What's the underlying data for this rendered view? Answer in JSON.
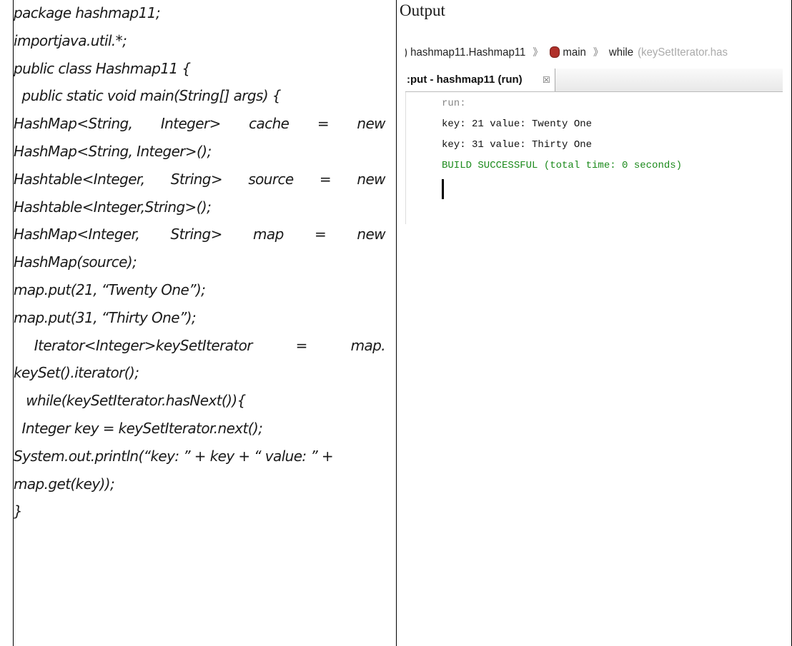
{
  "code": {
    "lines": [
      {
        "text": "package hashmap11;"
      },
      {
        "text": "importjava.util.*;"
      },
      {
        "text": "public class Hashmap11 {"
      },
      {
        "text": "  public static void main(String[] args) {"
      },
      {
        "parts": [
          "HashMap<String,",
          "Integer>",
          "cache",
          "=",
          "new"
        ]
      },
      {
        "text": "HashMap<String, Integer>();"
      },
      {
        "parts": [
          "Hashtable<Integer,",
          "String>",
          "source",
          "=",
          "new"
        ]
      },
      {
        "text": "Hashtable<Integer,String>();"
      },
      {
        "parts": [
          "HashMap<Integer,",
          "String>",
          "map",
          "=",
          "new"
        ]
      },
      {
        "text": "HashMap(source);"
      },
      {
        "text": "map.put(21, “Twenty One”);"
      },
      {
        "text": "map.put(31, “Thirty One”);"
      },
      {
        "parts": [
          "     Iterator<Integer>keySetIterator",
          "=",
          "map."
        ]
      },
      {
        "text": "keySet().iterator();"
      },
      {
        "text": "   while(keySetIterator.hasNext()){"
      },
      {
        "text": "  Integer key = keySetIterator.next();"
      },
      {
        "text": "System.out.println(“key: ” + key + “ value: ” +"
      },
      {
        "text": "map.get(key));"
      },
      {
        "text": "}"
      }
    ]
  },
  "output": {
    "heading": "Output",
    "ide": {
      "breadcrumb": {
        "class_crumb": ") hashmap11.Hashmap11",
        "separator": "》",
        "method_crumb": "main",
        "loop_crumb": "while",
        "loop_detail": "(keySetIterator.has"
      },
      "tab": {
        "label": ":put - hashmap11 (run)",
        "close": "☒"
      },
      "console": {
        "lines": [
          "run:",
          "key: 21 value: Twenty One",
          "key: 31 value: Thirty One",
          "BUILD SUCCESSFUL (total time: 0 seconds)"
        ]
      }
    }
  }
}
